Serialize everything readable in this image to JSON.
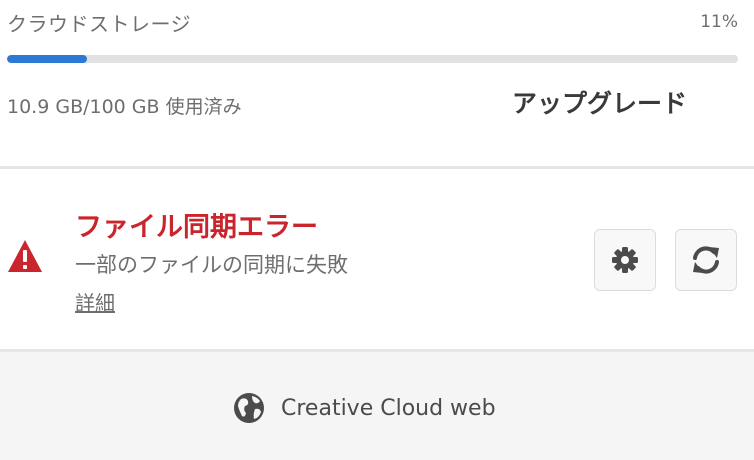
{
  "storage": {
    "title": "クラウドストレージ",
    "percent_label": "11%",
    "progress": 0.11,
    "usage": "10.9 GB/100 GB 使用済み",
    "upgrade_label": "アップグレード"
  },
  "sync_error": {
    "title": "ファイル同期エラー",
    "description": "一部のファイルの同期に失敗",
    "details_label": "詳細"
  },
  "footer": {
    "web_label": "Creative Cloud web"
  },
  "icons": [
    "warning-icon",
    "gear-icon",
    "refresh-icon",
    "globe-icon"
  ],
  "colors": {
    "accent": "#2d7ad6",
    "error": "#c9252c"
  }
}
